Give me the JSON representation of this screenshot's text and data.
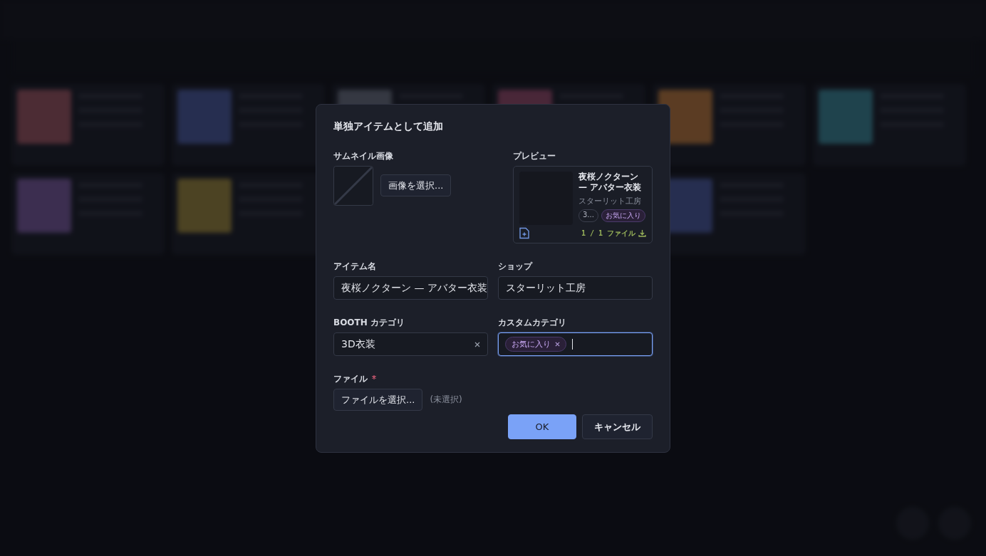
{
  "dialog": {
    "title": "単独アイテムとして追加",
    "thumbnail": {
      "label": "サムネイル画像",
      "button": "画像を選択..."
    },
    "preview": {
      "label": "プレビュー",
      "title": "夜桜ノクターン — アバター衣装",
      "shop": "スターリット工房",
      "tags": [
        {
          "text": "3...",
          "kind": "category"
        },
        {
          "text": "お気に入り",
          "kind": "custom"
        }
      ],
      "file_count": "1 / 1 ファイル"
    },
    "item_name": {
      "label": "アイテム名",
      "value": "夜桜ノクターン — アバター衣装"
    },
    "shop": {
      "label": "ショップ",
      "value": "スターリット工房"
    },
    "booth_category": {
      "label": "BOOTH カテゴリ",
      "value": "3D衣装",
      "clearable": true
    },
    "custom_category": {
      "label": "カスタムカテゴリ",
      "tags": [
        "お気に入り"
      ],
      "focused": true
    },
    "file": {
      "label": "ファイル",
      "required": true,
      "button": "ファイルを選択...",
      "status": "(未選択)"
    },
    "buttons": [
      {
        "label": "OK",
        "kind": "primary"
      },
      {
        "label": "キャンセル",
        "kind": "secondary"
      }
    ]
  }
}
